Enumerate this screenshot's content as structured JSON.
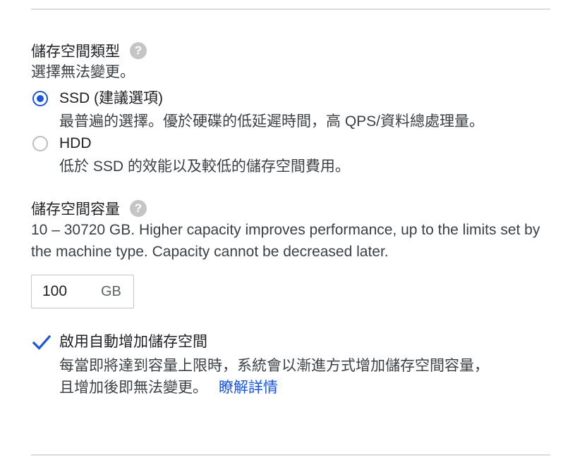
{
  "storage_type": {
    "title": "儲存空間類型",
    "help_icon": "help-circle-icon",
    "description": "選擇無法變更。",
    "options": [
      {
        "label": "SSD (建議選項)",
        "description": "最普遍的選擇。優於硬碟的低延遲時間，高 QPS/資料總處理量。",
        "selected": true
      },
      {
        "label": "HDD",
        "description": "低於 SSD 的效能以及較低的儲存空間費用。",
        "selected": false
      }
    ]
  },
  "storage_capacity": {
    "title": "儲存空間容量",
    "help_icon": "help-circle-icon",
    "description": "10 – 30720 GB. Higher capacity improves performance, up to the limits set by the machine type. Capacity cannot be decreased later.",
    "value": "100",
    "unit": "GB"
  },
  "auto_increase": {
    "checked": true,
    "label": "啟用自動增加儲存空間",
    "description_line1": "每當即將達到容量上限時，系統會以漸進方式增加儲存空間容量，",
    "description_line2": "且增加後即無法變更。",
    "link_label": "瞭解詳情"
  },
  "colors": {
    "accent": "#1a56db",
    "text": "#202124",
    "secondary_text": "#3c4043",
    "divider": "#dadce0"
  }
}
